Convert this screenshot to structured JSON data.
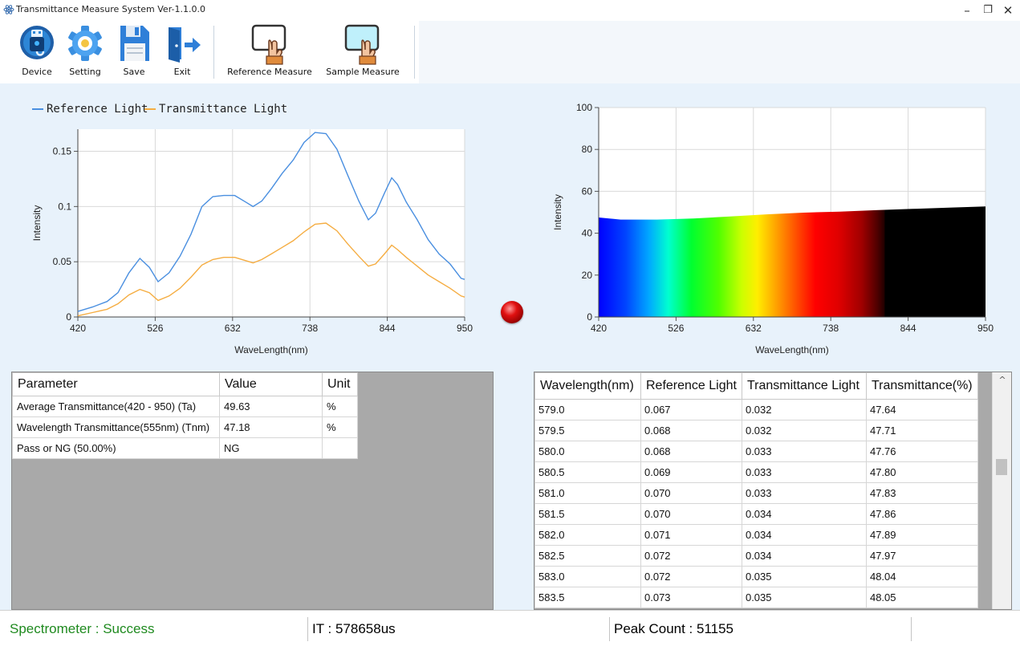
{
  "window": {
    "title": "Transmittance Measure System Ver-1.1.0.0",
    "controls": {
      "minimize": "–",
      "restore": "❐",
      "close": "✕"
    }
  },
  "toolbar": {
    "buttons": [
      {
        "label": "Device",
        "icon": "usb-icon"
      },
      {
        "label": "Setting",
        "icon": "gear-icon"
      },
      {
        "label": "Save",
        "icon": "floppy-disk-icon"
      },
      {
        "label": "Exit",
        "icon": "exit-door-icon"
      },
      {
        "label": "Reference Measure",
        "icon": "hand-card-icon"
      },
      {
        "label": "Sample Measure",
        "icon": "hand-card-blue-icon"
      }
    ]
  },
  "chart_data": [
    {
      "type": "line",
      "title": "",
      "xlabel": "WaveLength(nm)",
      "ylabel": "Intensity",
      "xlim": [
        420,
        950
      ],
      "ylim": [
        0,
        0.17
      ],
      "xticks": [
        "420",
        "526",
        "632",
        "738",
        "844",
        "950"
      ],
      "yticks": [
        "0",
        "0.05",
        "0.1",
        "0.15"
      ],
      "legend": "top-left",
      "grid": true,
      "series": [
        {
          "name": "Reference Light",
          "color": "#4a8fe0",
          "x": [
            420,
            440,
            460,
            475,
            490,
            505,
            518,
            530,
            545,
            560,
            575,
            590,
            605,
            620,
            635,
            650,
            660,
            672,
            685,
            700,
            715,
            730,
            745,
            760,
            775,
            790,
            805,
            818,
            828,
            840,
            850,
            858,
            870,
            885,
            900,
            915,
            930,
            945,
            950
          ],
          "y": [
            0.005,
            0.009,
            0.014,
            0.022,
            0.04,
            0.053,
            0.045,
            0.032,
            0.04,
            0.055,
            0.075,
            0.1,
            0.109,
            0.11,
            0.11,
            0.104,
            0.1,
            0.105,
            0.116,
            0.13,
            0.142,
            0.158,
            0.167,
            0.166,
            0.152,
            0.128,
            0.105,
            0.088,
            0.094,
            0.112,
            0.126,
            0.12,
            0.104,
            0.088,
            0.07,
            0.057,
            0.048,
            0.035,
            0.034
          ]
        },
        {
          "name": "Transmittance Light",
          "color": "#f5ad42",
          "x": [
            420,
            440,
            460,
            475,
            490,
            505,
            518,
            530,
            545,
            560,
            575,
            590,
            605,
            620,
            635,
            650,
            660,
            672,
            685,
            700,
            715,
            730,
            745,
            760,
            775,
            790,
            805,
            818,
            828,
            840,
            850,
            858,
            870,
            885,
            900,
            915,
            930,
            945,
            950
          ],
          "y": [
            0.001,
            0.004,
            0.007,
            0.012,
            0.02,
            0.025,
            0.022,
            0.015,
            0.019,
            0.026,
            0.036,
            0.047,
            0.052,
            0.054,
            0.054,
            0.051,
            0.049,
            0.052,
            0.057,
            0.063,
            0.069,
            0.077,
            0.084,
            0.085,
            0.078,
            0.066,
            0.055,
            0.046,
            0.048,
            0.057,
            0.065,
            0.061,
            0.054,
            0.046,
            0.038,
            0.032,
            0.026,
            0.019,
            0.018
          ]
        }
      ]
    },
    {
      "type": "area",
      "title": "",
      "xlabel": "WaveLength(nm)",
      "ylabel": "Intensity",
      "xlim": [
        420,
        950
      ],
      "ylim": [
        0,
        100
      ],
      "xticks": [
        "420",
        "526",
        "632",
        "738",
        "844",
        "950"
      ],
      "yticks": [
        "0",
        "20",
        "40",
        "60",
        "80",
        "100"
      ],
      "grid": true,
      "fill": "visible-spectrum gradient (violet to red), black beyond 780nm",
      "series": [
        {
          "name": "",
          "x": [
            420,
            450,
            500,
            550,
            600,
            650,
            700,
            750,
            800,
            850,
            900,
            950
          ],
          "y": [
            47.5,
            46.5,
            46.5,
            47.0,
            48.0,
            49.0,
            49.8,
            50.3,
            51.0,
            51.6,
            52.2,
            52.8
          ]
        }
      ]
    }
  ],
  "param_table": {
    "headers": [
      "Parameter",
      "Value",
      "Unit"
    ],
    "rows": [
      [
        "Average Transmittance(420 - 950) (Ta)",
        "49.63",
        "%"
      ],
      [
        "Wavelength Transmittance(555nm) (Tnm)",
        "47.18",
        "%"
      ],
      [
        "Pass or NG (50.00%)",
        "NG",
        ""
      ]
    ]
  },
  "data_table": {
    "headers": [
      "Wavelength(nm)",
      "Reference Light",
      "Transmittance Light",
      "Transmittance(%)"
    ],
    "rows": [
      [
        "579.0",
        "0.067",
        "0.032",
        "47.64"
      ],
      [
        "579.5",
        "0.068",
        "0.032",
        "47.71"
      ],
      [
        "580.0",
        "0.068",
        "0.033",
        "47.76"
      ],
      [
        "580.5",
        "0.069",
        "0.033",
        "47.80"
      ],
      [
        "581.0",
        "0.070",
        "0.033",
        "47.83"
      ],
      [
        "581.5",
        "0.070",
        "0.034",
        "47.86"
      ],
      [
        "582.0",
        "0.071",
        "0.034",
        "47.89"
      ],
      [
        "582.5",
        "0.072",
        "0.034",
        "47.97"
      ],
      [
        "583.0",
        "0.072",
        "0.035",
        "48.04"
      ],
      [
        "583.5",
        "0.073",
        "0.035",
        "48.05"
      ]
    ],
    "scroll_up": "^"
  },
  "status": {
    "spectrometer": "Spectrometer : Success",
    "spectrometer_color": "#1f8a1f",
    "it": "IT : 578658us",
    "peak": "Peak Count : 51155"
  },
  "indicator": {
    "state": "red"
  }
}
